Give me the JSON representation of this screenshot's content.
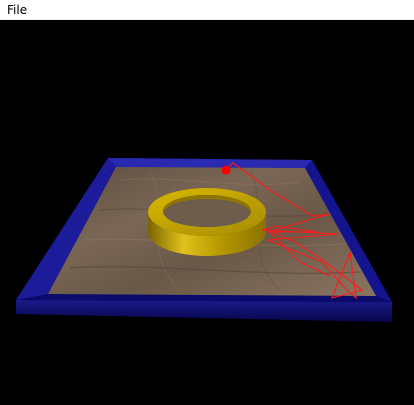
{
  "menubar": {
    "items": [
      {
        "label": "File"
      }
    ]
  },
  "scene": {
    "background_color": "#000000",
    "frame_color": "#0b0b6e",
    "floor_color": "#6b5a4a",
    "ring_color": "#c9a800",
    "trace_color": "#ff1a1a",
    "ball_color": "#ff0000"
  }
}
